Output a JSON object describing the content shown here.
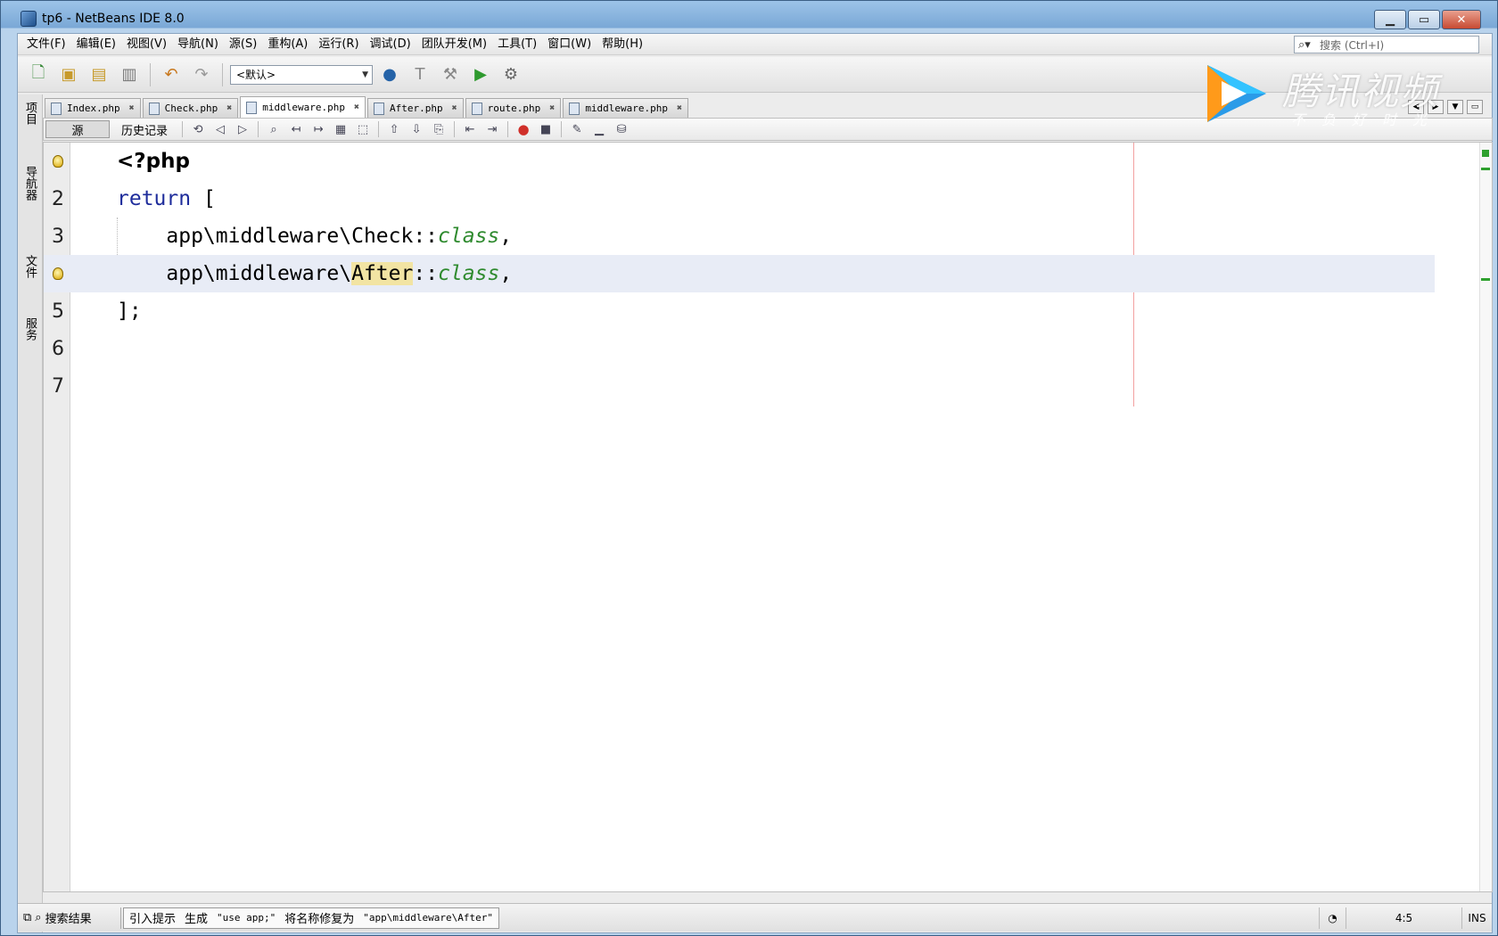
{
  "window": {
    "title": "tp6 - NetBeans IDE 8.0",
    "min_icon": "minimize-glyph",
    "max_icon": "maximize-glyph",
    "close_glyph": "✕"
  },
  "menu": [
    "文件(F)",
    "编辑(E)",
    "视图(V)",
    "导航(N)",
    "源(S)",
    "重构(A)",
    "运行(R)",
    "调试(D)",
    "团队开发(M)",
    "工具(T)",
    "窗口(W)",
    "帮助(H)"
  ],
  "search": {
    "placeholder": "搜索 (Ctrl+I)"
  },
  "toolbar": {
    "config_value": "<默认>"
  },
  "side_tabs": [
    "项目",
    "导航器",
    "文件",
    "服务"
  ],
  "tabs": [
    {
      "label": "Index.php",
      "active": false
    },
    {
      "label": "Check.php",
      "active": false
    },
    {
      "label": "middleware.php",
      "active": true
    },
    {
      "label": "After.php",
      "active": false
    },
    {
      "label": "route.php",
      "active": false
    },
    {
      "label": "middleware.php",
      "active": false
    }
  ],
  "editor_toolbar": {
    "source_tab": "源",
    "history_tab": "历史记录"
  },
  "code": {
    "line_numbers": [
      "2",
      "3",
      "5",
      "6",
      "7"
    ],
    "open_tag": "<?php",
    "return_kw": "return",
    "open_bracket": "[",
    "check_prefix": "app\\middleware\\Check::",
    "after_prefix": "app\\middleware\\",
    "after_highlight": "After",
    "after_suffix": "::",
    "class_kw": "class",
    "comma": ",",
    "closing": "];"
  },
  "status": {
    "search_results": "搜索结果",
    "hint_label": "引入提示",
    "hint_generate": "生成",
    "hint_use": "\"use app;\"",
    "hint_fix": "将名称修复为",
    "hint_fix_target": "\"app\\middleware\\After\"",
    "position": "4:5",
    "mode": "INS"
  },
  "watermark": {
    "brand": "腾讯视频",
    "slogan": "不负好时光"
  },
  "colors": {
    "keyword": "#1e2c9b",
    "class_italic": "#2e8a2e",
    "occurrence_mark": "#f2e4a3",
    "current_line": "#e8ecf6"
  }
}
